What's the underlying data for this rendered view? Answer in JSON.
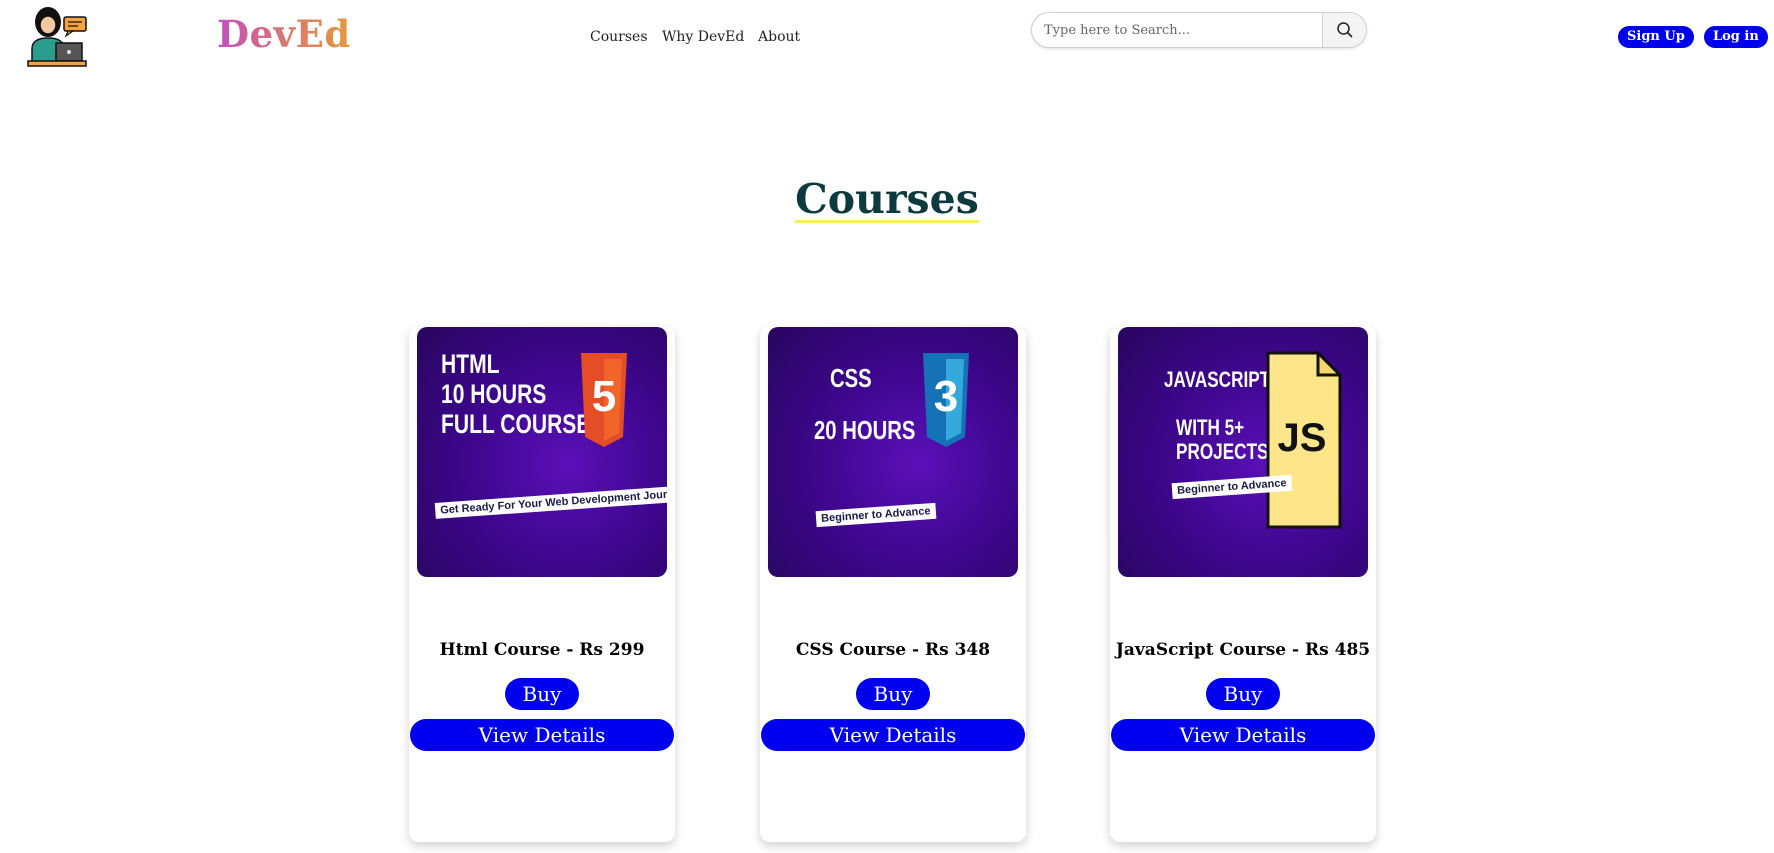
{
  "navbar": {
    "brand": "DevEd",
    "links": [
      "Courses",
      "Why DevEd",
      "About"
    ],
    "search_placeholder": "Type here to Search...",
    "signup_label": "Sign Up",
    "login_label": "Log in"
  },
  "main": {
    "section_title": "Courses",
    "courses": [
      {
        "title": "Html Course - Rs 299",
        "buy_label": "Buy",
        "details_label": "View Details",
        "thumb_lines": [
          "HTML",
          "10 HOURS",
          "FULL COURSE"
        ],
        "thumb_tag": "Get Ready For Your Web Development Journey",
        "badge": "5",
        "badge_color": "#e44d26"
      },
      {
        "title": "CSS Course - Rs 348",
        "buy_label": "Buy",
        "details_label": "View Details",
        "thumb_lines": [
          "CSS",
          "20 HOURS"
        ],
        "thumb_tag": "Beginner to Advance",
        "badge": "3",
        "badge_color": "#2196f3"
      },
      {
        "title": "JavaScript Course - Rs 485",
        "buy_label": "Buy",
        "details_label": "View Details",
        "thumb_lines": [
          "JAVASCRIPT",
          "WITH 5+",
          "PROJECTS"
        ],
        "thumb_tag": "Beginner to Advance",
        "badge": "JS",
        "badge_color": "#fde68a"
      }
    ]
  },
  "colors": {
    "accent": "#0000ee",
    "title": "#0c3a3f",
    "underline": "#f3f05a"
  }
}
